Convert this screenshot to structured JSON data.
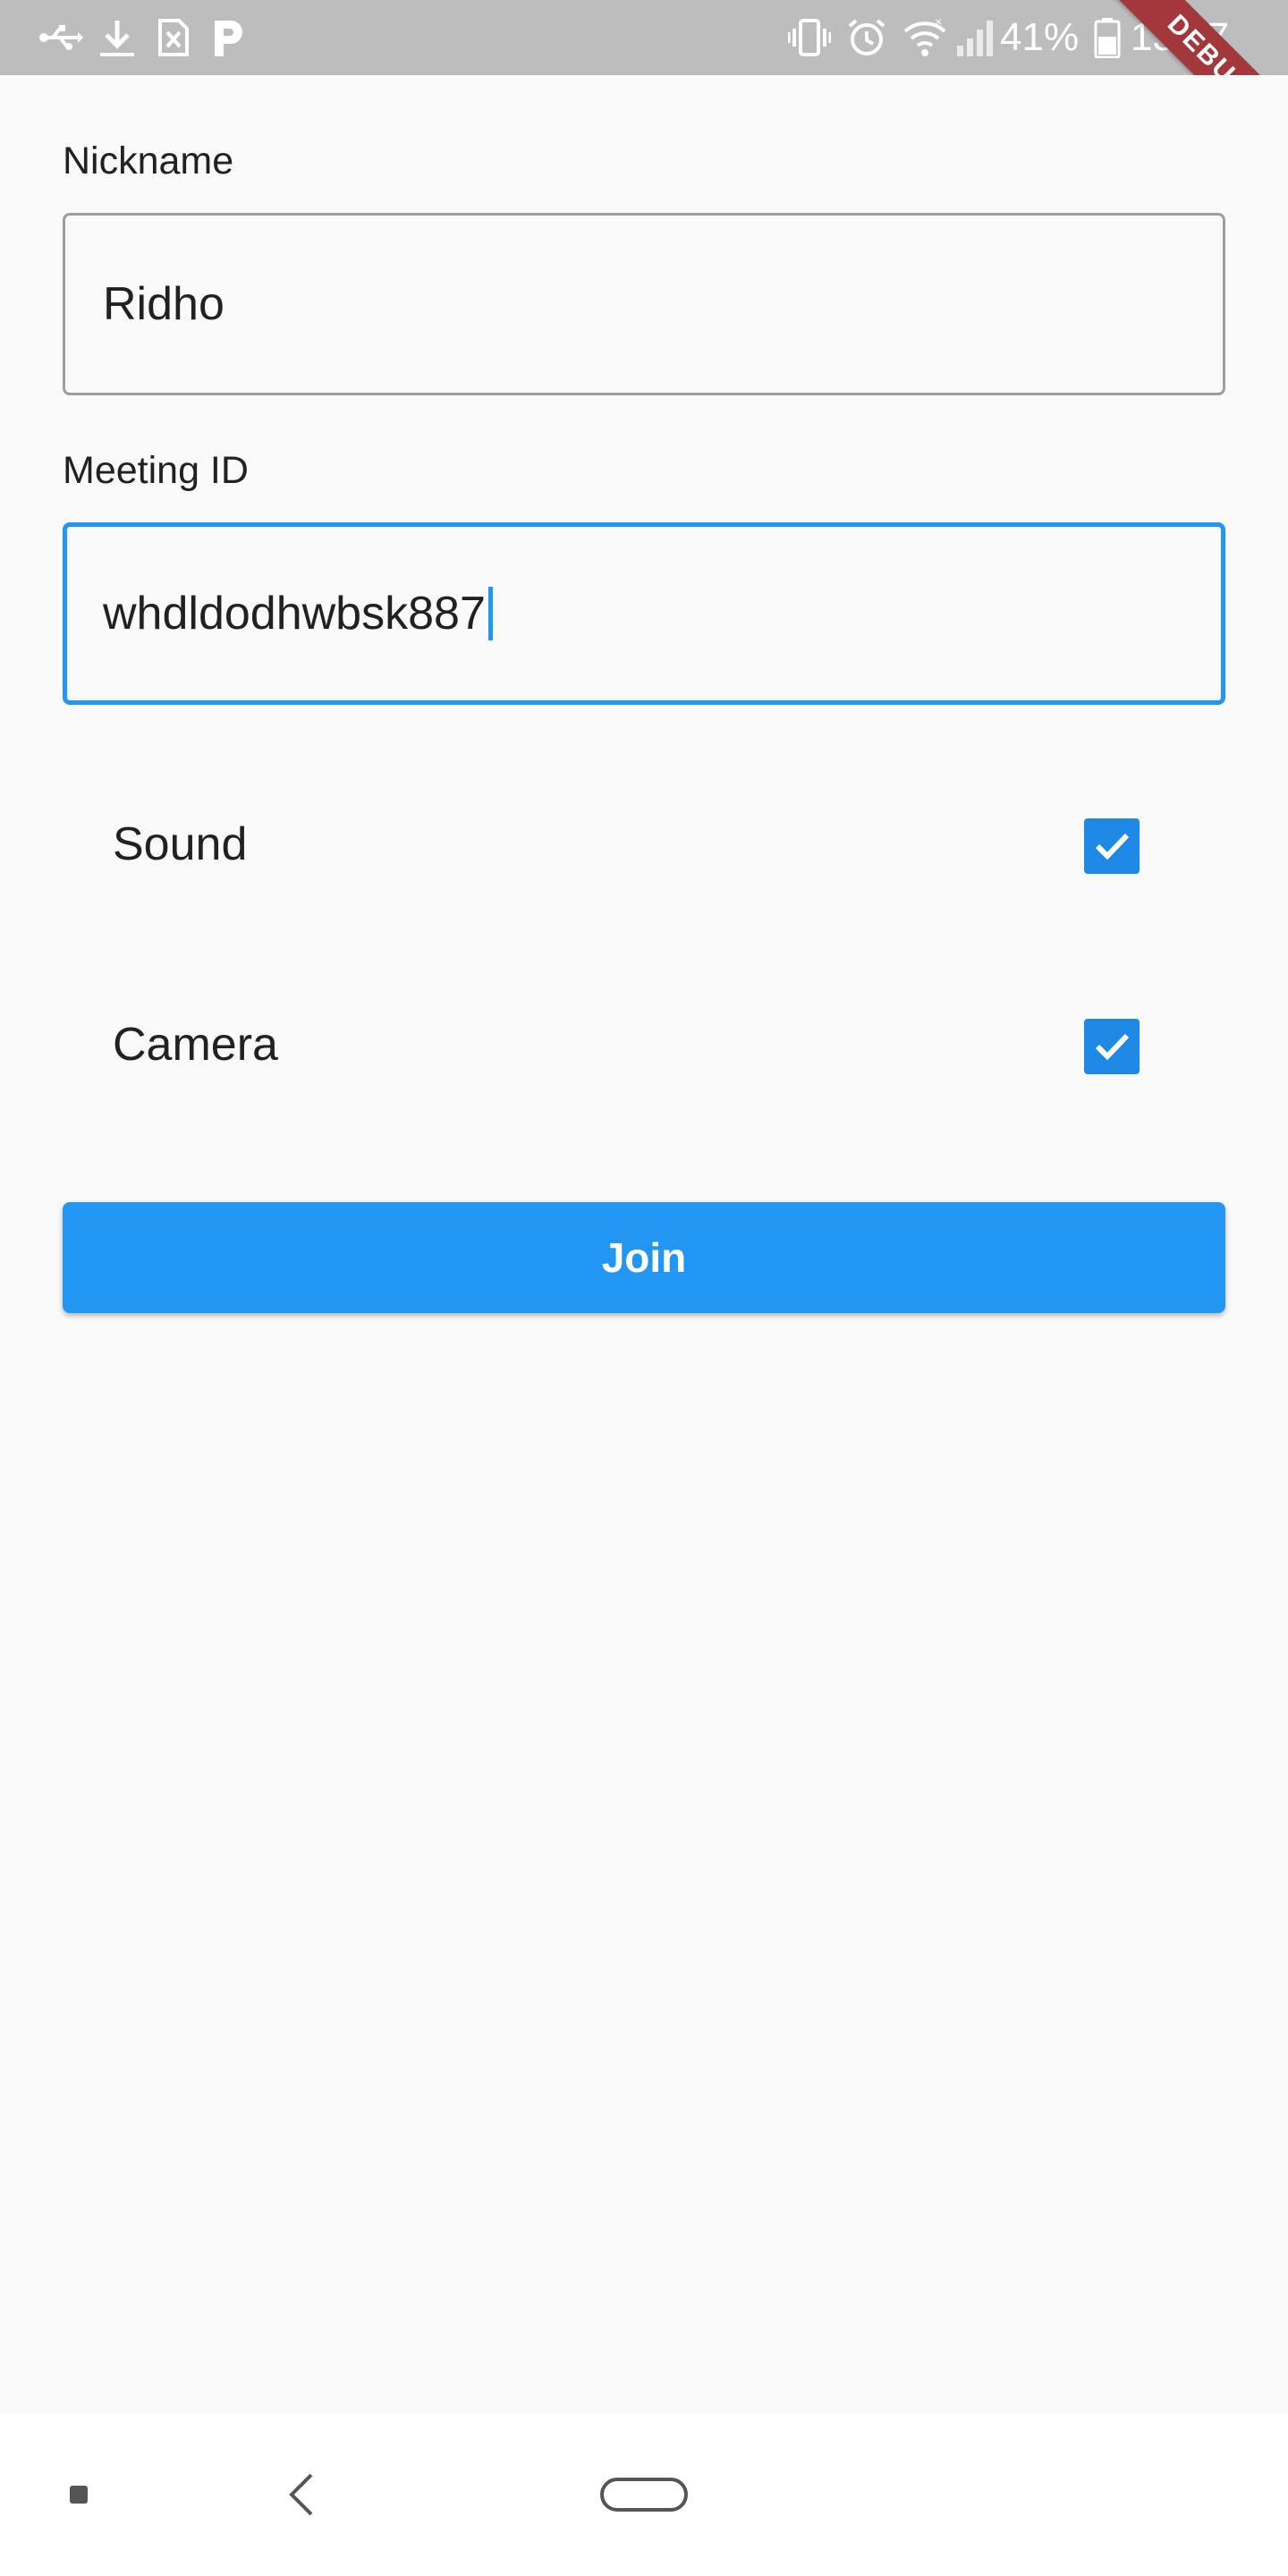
{
  "status_bar": {
    "battery_percent": "41%",
    "time": "13:17",
    "left_icons": [
      "usb-icon",
      "download-icon",
      "sim-error-icon",
      "parking-app-icon"
    ],
    "right_icons": [
      "vibrate-icon",
      "alarm-icon",
      "wifi-icon",
      "signal-icon",
      "battery-icon"
    ]
  },
  "debug_banner": "DEBUG",
  "form": {
    "nickname": {
      "label": "Nickname",
      "value": "Ridho"
    },
    "meeting_id": {
      "label": "Meeting ID",
      "value": "whdldodhwbsk887"
    },
    "sound": {
      "label": "Sound",
      "checked": true
    },
    "camera": {
      "label": "Camera",
      "checked": true
    },
    "join_label": "Join"
  },
  "colors": {
    "accent": "#2196f3",
    "checkbox": "#1e88e5",
    "status_bar": "#bdbdbd",
    "debug_ribbon": "#a3383c",
    "background": "#fafafa"
  },
  "nav_bar": {
    "buttons": [
      "recent-apps-icon",
      "back-icon",
      "home-icon"
    ]
  }
}
